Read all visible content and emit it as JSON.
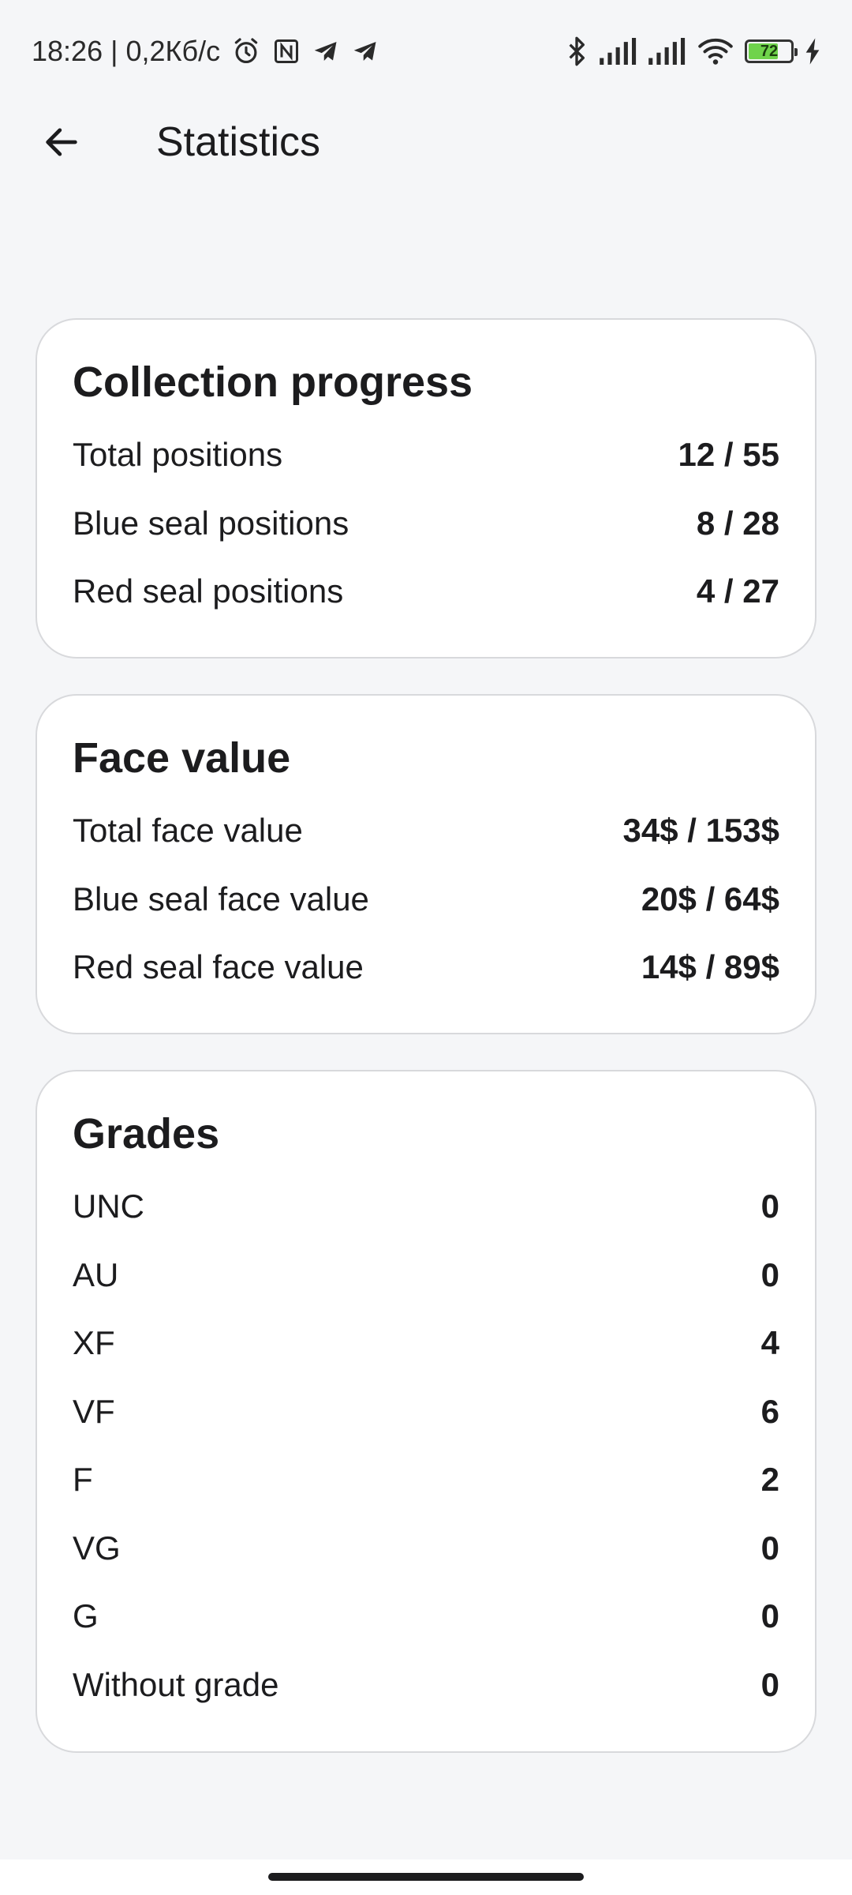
{
  "status_bar": {
    "time_speed": "18:26 | 0,2Кб/с",
    "battery_level": "72",
    "battery_fraction": 0.72,
    "battery_color": "#6fd34b",
    "icons": [
      "alarm-icon",
      "nfc-icon",
      "telegram-icon",
      "telegram-icon",
      "bluetooth-icon",
      "signal-icon",
      "signal-icon",
      "wifi-icon",
      "battery-icon",
      "charging-icon"
    ]
  },
  "app_bar": {
    "back_icon": "arrow-left-icon",
    "title": "Statistics"
  },
  "collection_progress": {
    "title": "Collection progress",
    "rows": [
      {
        "label": "Total positions",
        "value": "12 / 55"
      },
      {
        "label": "Blue seal positions",
        "value": "8 / 28"
      },
      {
        "label": "Red seal positions",
        "value": "4 / 27"
      }
    ]
  },
  "face_value": {
    "title": "Face value",
    "rows": [
      {
        "label": "Total face value",
        "value": "34$ / 153$"
      },
      {
        "label": "Blue seal face value",
        "value": "20$ / 64$"
      },
      {
        "label": "Red seal face value",
        "value": "14$ / 89$"
      }
    ]
  },
  "grades": {
    "title": "Grades",
    "rows": [
      {
        "label": "UNC",
        "value": "0"
      },
      {
        "label": "AU",
        "value": "0"
      },
      {
        "label": "XF",
        "value": "4"
      },
      {
        "label": "VF",
        "value": "6"
      },
      {
        "label": "F",
        "value": "2"
      },
      {
        "label": "VG",
        "value": "0"
      },
      {
        "label": "G",
        "value": "0"
      },
      {
        "label": "Without grade",
        "value": "0"
      }
    ]
  }
}
